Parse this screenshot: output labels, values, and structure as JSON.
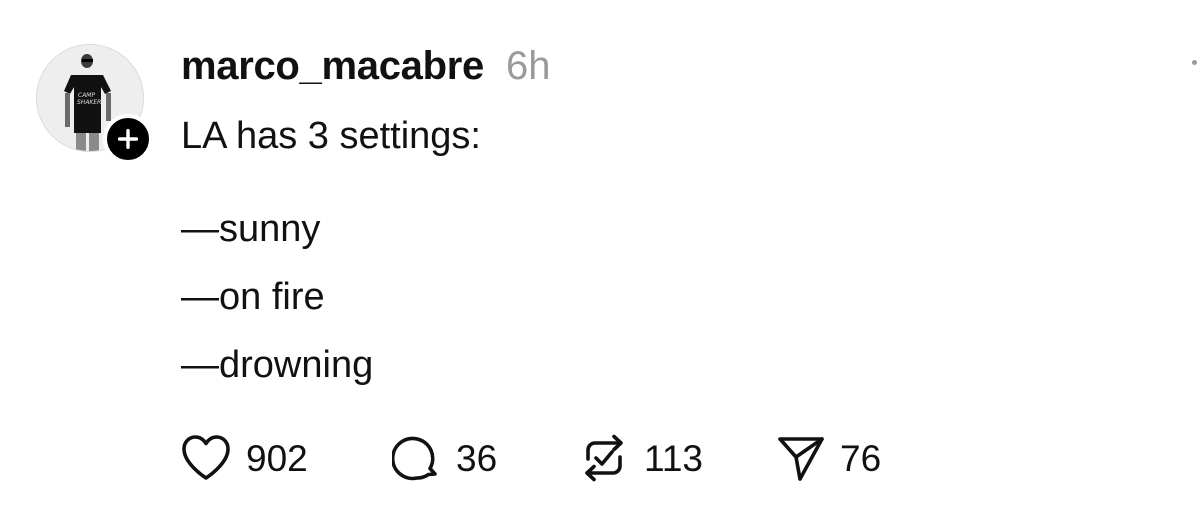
{
  "post": {
    "author": {
      "username": "marco_macabre",
      "avatar_icon": "user-avatar-photo",
      "follow_icon": "plus-icon"
    },
    "timestamp": "6h",
    "text": {
      "intro": "LA has 3 settings:",
      "items": [
        "—sunny",
        "—on fire",
        "—drowning"
      ]
    },
    "actions": {
      "likes": {
        "icon": "heart-icon",
        "count": "902"
      },
      "replies": {
        "icon": "comment-icon",
        "count": "36"
      },
      "reposts": {
        "icon": "repost-icon",
        "count": "113"
      },
      "shares": {
        "icon": "send-icon",
        "count": "76"
      }
    }
  },
  "colors": {
    "text": "#111111",
    "muted": "#9a9a9a",
    "badge": "#000000",
    "background": "#ffffff"
  }
}
